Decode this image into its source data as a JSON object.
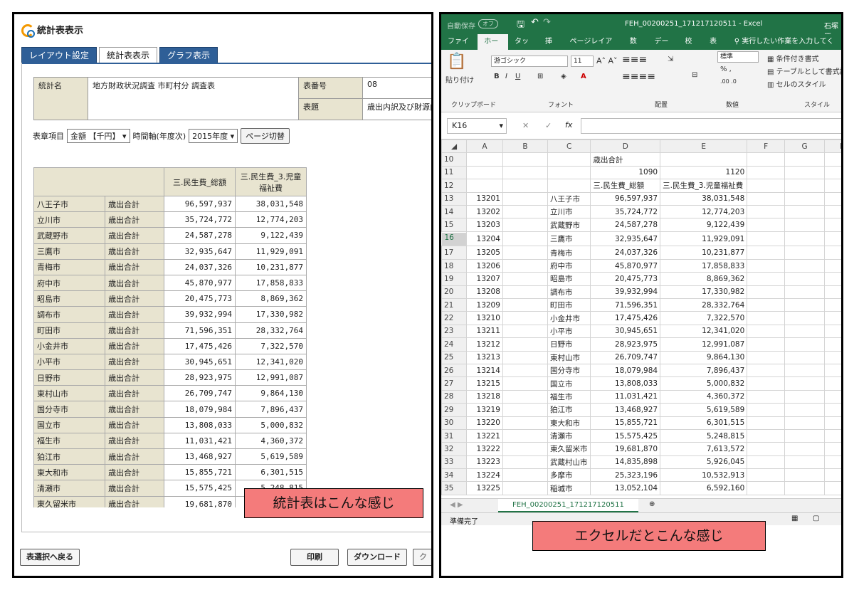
{
  "left": {
    "title": "統計表表示",
    "tabs": [
      "レイアウト設定",
      "統計表表示",
      "グラフ表示"
    ],
    "info": {
      "label_name": "統計名",
      "name": "地方財政状況調査 市町村分 調査表",
      "label_num": "表番号",
      "num": "08",
      "label_title": "表題",
      "title": "歳出内訳及び財源内訳"
    },
    "controls": {
      "item_label": "表章項目",
      "item_value": "金額 【千円】",
      "time_label": "時間軸(年度次)",
      "time_value": "2015年度",
      "page_button": "ページ切替"
    },
    "table": {
      "headers": [
        "三.民生費_総額",
        "三.民生費_3.児童福祉費"
      ],
      "rows": [
        [
          "八王子市",
          "歳出合計",
          "96,597,937",
          "38,031,548"
        ],
        [
          "立川市",
          "歳出合計",
          "35,724,772",
          "12,774,203"
        ],
        [
          "武蔵野市",
          "歳出合計",
          "24,587,278",
          "9,122,439"
        ],
        [
          "三鷹市",
          "歳出合計",
          "32,935,647",
          "11,929,091"
        ],
        [
          "青梅市",
          "歳出合計",
          "24,037,326",
          "10,231,877"
        ],
        [
          "府中市",
          "歳出合計",
          "45,870,977",
          "17,858,833"
        ],
        [
          "昭島市",
          "歳出合計",
          "20,475,773",
          "8,869,362"
        ],
        [
          "調布市",
          "歳出合計",
          "39,932,994",
          "17,330,982"
        ],
        [
          "町田市",
          "歳出合計",
          "71,596,351",
          "28,332,764"
        ],
        [
          "小金井市",
          "歳出合計",
          "17,475,426",
          "7,322,570"
        ],
        [
          "小平市",
          "歳出合計",
          "30,945,651",
          "12,341,020"
        ],
        [
          "日野市",
          "歳出合計",
          "28,923,975",
          "12,991,087"
        ],
        [
          "東村山市",
          "歳出合計",
          "26,709,747",
          "9,864,130"
        ],
        [
          "国分寺市",
          "歳出合計",
          "18,079,984",
          "7,896,437"
        ],
        [
          "国立市",
          "歳出合計",
          "13,808,033",
          "5,000,832"
        ],
        [
          "福生市",
          "歳出合計",
          "11,031,421",
          "4,360,372"
        ],
        [
          "狛江市",
          "歳出合計",
          "13,468,927",
          "5,619,589"
        ],
        [
          "東大和市",
          "歳出合計",
          "15,855,721",
          "6,301,515"
        ],
        [
          "清瀬市",
          "歳出合計",
          "15,575,425",
          "5,248,815"
        ],
        [
          "東久留米市",
          "歳出合計",
          "19,681,870",
          ""
        ]
      ]
    },
    "callout": "統計表はこんな感じ",
    "buttons": {
      "back": "表選択へ戻る",
      "print": "印刷",
      "download": "ダウンロード",
      "cut": "ク"
    }
  },
  "excel": {
    "autosave": "自動保存",
    "autosave_state": "オフ",
    "filename": "FEH_00200251_171217120511  -  Excel",
    "user": "石塚原",
    "menu": [
      "ファイル",
      "ホーム",
      "タッチ",
      "挿入",
      "ページレイアウト",
      "数式",
      "データ",
      "校閲",
      "表示",
      "実行したい作業を入力してください"
    ],
    "ribbon": {
      "paste": "貼り付け",
      "font": "游ゴシック",
      "size": "11",
      "numfmt": "標準",
      "cond": "条件付き書式",
      "table": "テーブルとして書式設定",
      "cellstyle": "セルのスタイル",
      "g_clip": "クリップボード",
      "g_font": "フォント",
      "g_align": "配置",
      "g_num": "数値",
      "g_style": "スタイル"
    },
    "namebox": "K16",
    "fx": "fx",
    "cols": [
      "A",
      "B",
      "C",
      "D",
      "E",
      "F",
      "G",
      "H"
    ],
    "rows": [
      [
        "10",
        "",
        "",
        "",
        "歳出合計",
        "",
        ""
      ],
      [
        "11",
        "",
        "",
        "",
        "1090",
        "1120",
        ""
      ],
      [
        "12",
        "",
        "",
        "",
        "三.民生費_総額",
        "三.民生費_3.児童福祉費",
        ""
      ],
      [
        "13",
        "13201",
        "",
        "八王子市",
        "96,597,937",
        "38,031,548",
        ""
      ],
      [
        "14",
        "13202",
        "",
        "立川市",
        "35,724,772",
        "12,774,203",
        ""
      ],
      [
        "15",
        "13203",
        "",
        "武蔵野市",
        "24,587,278",
        "9,122,439",
        ""
      ],
      [
        "16",
        "13204",
        "",
        "三鷹市",
        "32,935,647",
        "11,929,091",
        ""
      ],
      [
        "17",
        "13205",
        "",
        "青梅市",
        "24,037,326",
        "10,231,877",
        ""
      ],
      [
        "18",
        "13206",
        "",
        "府中市",
        "45,870,977",
        "17,858,833",
        ""
      ],
      [
        "19",
        "13207",
        "",
        "昭島市",
        "20,475,773",
        "8,869,362",
        ""
      ],
      [
        "20",
        "13208",
        "",
        "調布市",
        "39,932,994",
        "17,330,982",
        ""
      ],
      [
        "21",
        "13209",
        "",
        "町田市",
        "71,596,351",
        "28,332,764",
        ""
      ],
      [
        "22",
        "13210",
        "",
        "小金井市",
        "17,475,426",
        "7,322,570",
        ""
      ],
      [
        "23",
        "13211",
        "",
        "小平市",
        "30,945,651",
        "12,341,020",
        ""
      ],
      [
        "24",
        "13212",
        "",
        "日野市",
        "28,923,975",
        "12,991,087",
        ""
      ],
      [
        "25",
        "13213",
        "",
        "東村山市",
        "26,709,747",
        "9,864,130",
        ""
      ],
      [
        "26",
        "13214",
        "",
        "国分寺市",
        "18,079,984",
        "7,896,437",
        ""
      ],
      [
        "27",
        "13215",
        "",
        "国立市",
        "13,808,033",
        "5,000,832",
        ""
      ],
      [
        "28",
        "13218",
        "",
        "福生市",
        "11,031,421",
        "4,360,372",
        ""
      ],
      [
        "29",
        "13219",
        "",
        "狛江市",
        "13,468,927",
        "5,619,589",
        ""
      ],
      [
        "30",
        "13220",
        "",
        "東大和市",
        "15,855,721",
        "6,301,515",
        ""
      ],
      [
        "31",
        "13221",
        "",
        "清瀬市",
        "15,575,425",
        "5,248,815",
        ""
      ],
      [
        "32",
        "13222",
        "",
        "東久留米市",
        "19,681,870",
        "7,613,572",
        ""
      ],
      [
        "33",
        "13223",
        "",
        "武蔵村山市",
        "14,835,898",
        "5,926,045",
        ""
      ],
      [
        "34",
        "13224",
        "",
        "多摩市",
        "25,323,196",
        "10,532,913",
        ""
      ],
      [
        "35",
        "13225",
        "",
        "稲城市",
        "13,052,104",
        "6,592,160",
        ""
      ]
    ],
    "sheet_tab": "FEH_00200251_171217120511",
    "status": "準備完了",
    "callout": "エクセルだとこんな感じ"
  }
}
